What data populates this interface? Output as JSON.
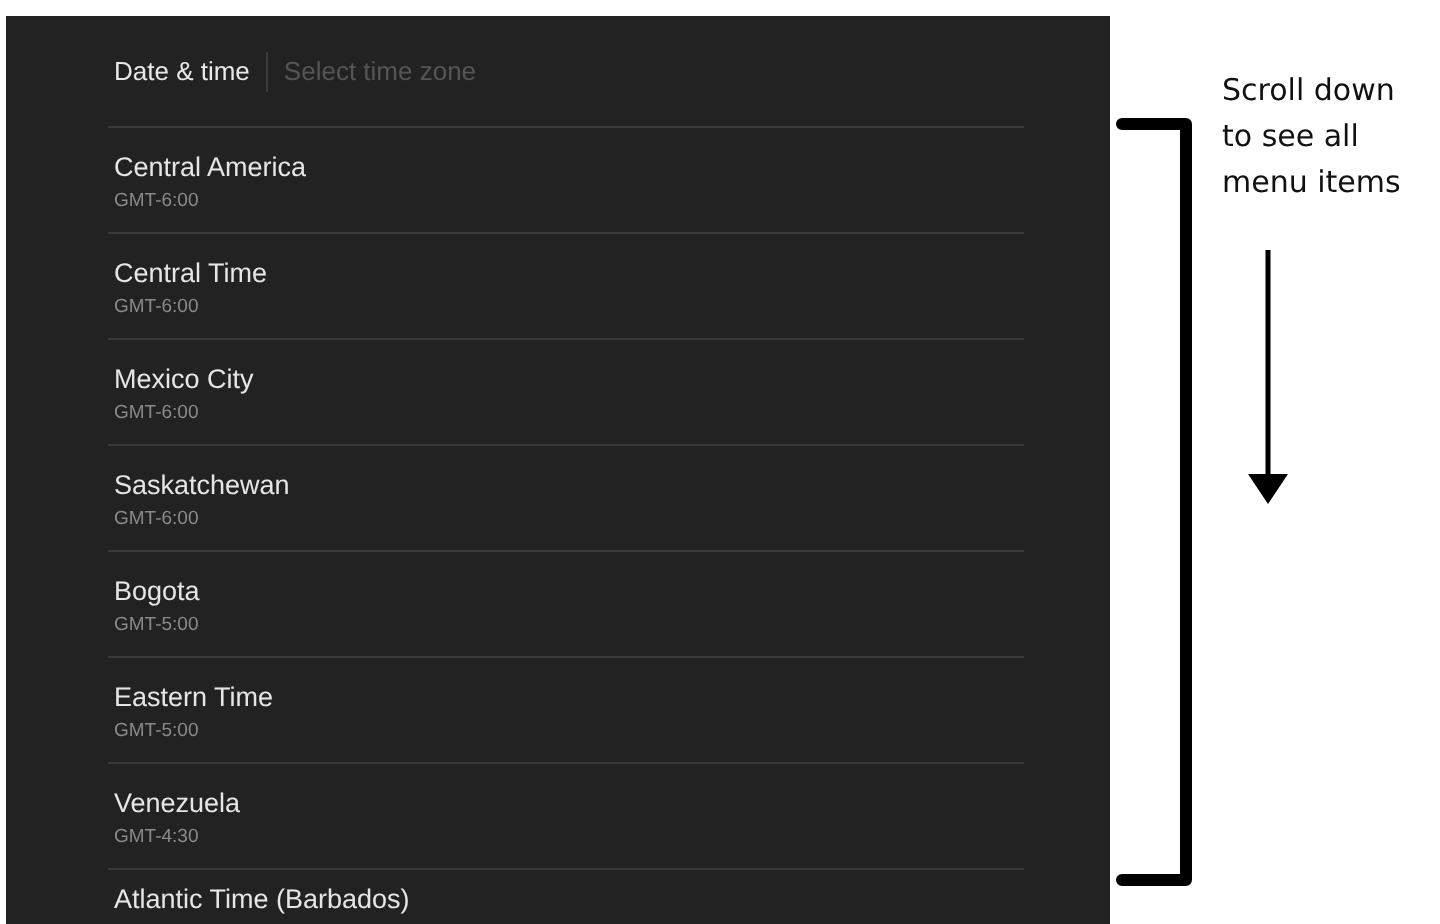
{
  "header": {
    "title": "Date & time",
    "subtitle": "Select time zone"
  },
  "time_zones": [
    {
      "name": "Central America",
      "offset": "GMT-6:00"
    },
    {
      "name": "Central Time",
      "offset": "GMT-6:00"
    },
    {
      "name": "Mexico City",
      "offset": "GMT-6:00"
    },
    {
      "name": "Saskatchewan",
      "offset": "GMT-6:00"
    },
    {
      "name": "Bogota",
      "offset": "GMT-5:00"
    },
    {
      "name": "Eastern Time",
      "offset": "GMT-5:00"
    },
    {
      "name": "Venezuela",
      "offset": "GMT-4:30"
    },
    {
      "name": "Atlantic Time (Barbados)"
    }
  ],
  "annotation": {
    "text": "Scroll down to see all menu items"
  }
}
